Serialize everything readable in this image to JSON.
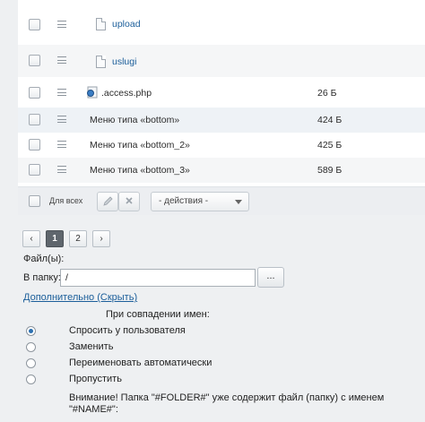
{
  "files": {
    "rows": [
      {
        "type": "folder",
        "name": "upload",
        "size": ""
      },
      {
        "type": "folder",
        "name": "uslugi",
        "size": ""
      },
      {
        "type": "php",
        "name": ".access.php",
        "size": "26 Б"
      },
      {
        "type": "menu",
        "name": "Меню типа «bottom»",
        "size": "424 Б"
      },
      {
        "type": "menu",
        "name": "Меню типа «bottom_2»",
        "size": "425 Б"
      },
      {
        "type": "menu",
        "name": "Меню типа «bottom_3»",
        "size": "589 Б"
      }
    ],
    "for_all_label": "Для всех",
    "actions_select": "- действия -"
  },
  "pagination": {
    "prev": "‹",
    "pages": [
      "1",
      "2"
    ],
    "current": "1",
    "next": "›"
  },
  "form": {
    "files_label": "Файл(ы):",
    "folder_label": "В папку:",
    "folder_value": "/",
    "browse_label": "...",
    "advanced_link": "Дополнительно (Скрыть)",
    "conflict_title": "При совпадении имен:",
    "options": [
      {
        "label": "Спросить у пользователя",
        "selected": true
      },
      {
        "label": "Заменить",
        "selected": false
      },
      {
        "label": "Переименовать автоматически",
        "selected": false
      },
      {
        "label": "Пропустить",
        "selected": false
      }
    ],
    "warning": "Внимание! Папка \"#FOLDER#\" уже содержит файл (папку) с именем \"#NAME#\":"
  }
}
